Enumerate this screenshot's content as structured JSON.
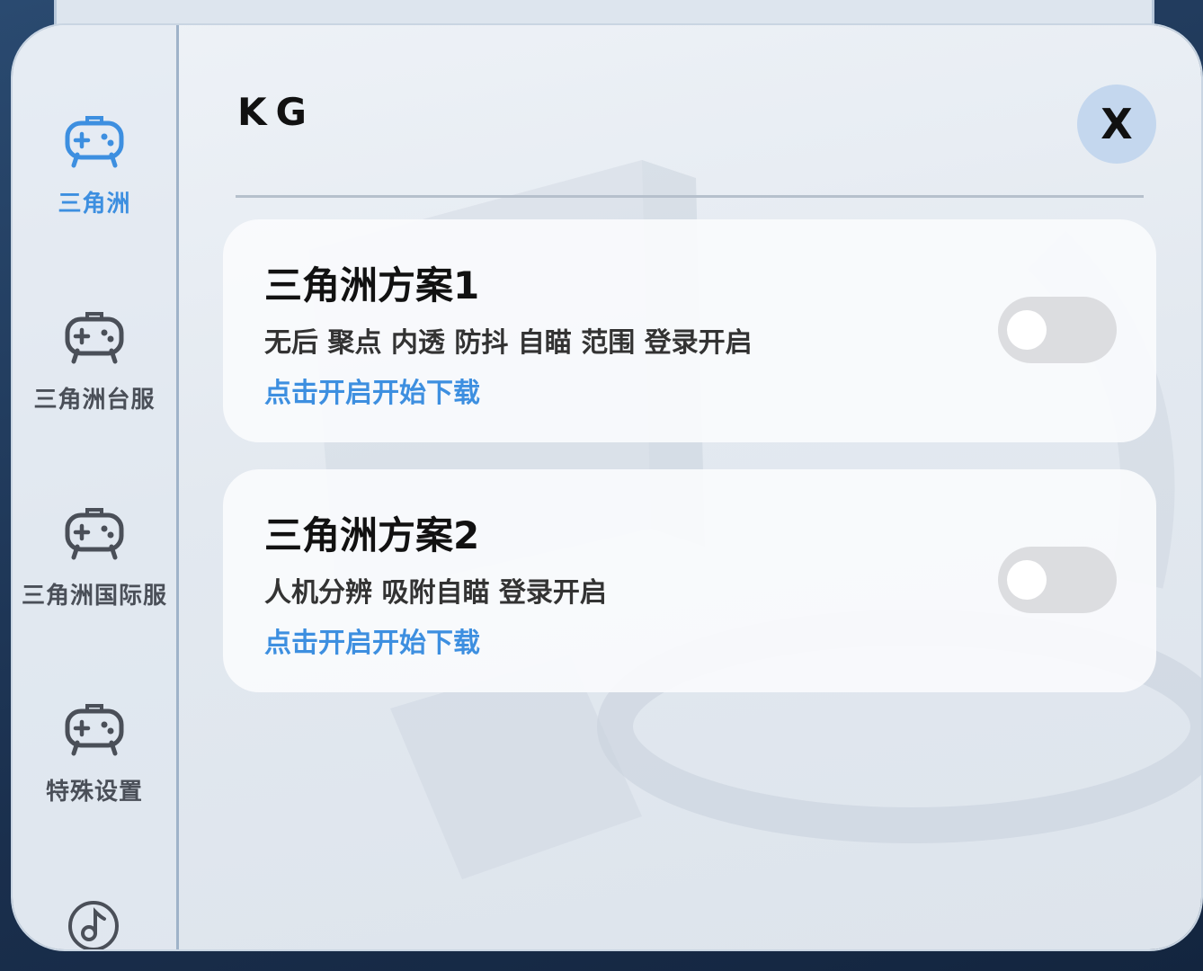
{
  "header": {
    "title": "KG",
    "close_label": "X"
  },
  "sidebar": {
    "items": [
      {
        "label": "三角洲",
        "icon": "gamepad-icon",
        "active": true
      },
      {
        "label": "三角洲台服",
        "icon": "gamepad-icon",
        "active": false
      },
      {
        "label": "三角洲国际服",
        "icon": "gamepad-icon",
        "active": false
      },
      {
        "label": "特殊设置",
        "icon": "gamepad-icon",
        "active": false
      }
    ],
    "bottom_icon": "music-note-icon"
  },
  "cards": [
    {
      "title": "三角洲方案1",
      "description": "无后 聚点 内透 防抖 自瞄 范围 登录开启",
      "link": "点击开启开始下载",
      "enabled": false
    },
    {
      "title": "三角洲方案2",
      "description": "人机分辨 吸附自瞄 登录开启",
      "link": "点击开启开始下载",
      "enabled": false
    }
  ],
  "colors": {
    "accent": "#3d8fe0",
    "toggle_off": "#dcdde0",
    "close_button": "#c4d7ee"
  }
}
